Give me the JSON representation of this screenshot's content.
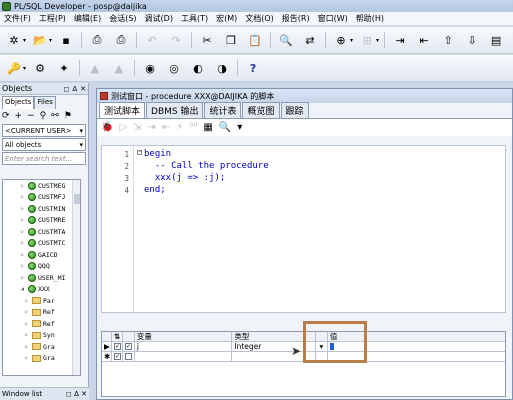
{
  "window": {
    "title": "PL/SQL Developer - posp@daijika"
  },
  "menu": [
    "文件(F)",
    "工程(P)",
    "编辑(E)",
    "会话(S)",
    "调试(D)",
    "工具(T)",
    "宏(M)",
    "文档(O)",
    "报告(R)",
    "窗口(W)",
    "帮助(H)"
  ],
  "objects_panel": {
    "title": "Objects",
    "tabs": [
      "Objects",
      "Files"
    ],
    "user_combo": "<CURRENT USER>",
    "filter_combo": "All objects",
    "search_placeholder": "Enter search text...",
    "tree": [
      {
        "label": "CUSTMEG",
        "type": "object"
      },
      {
        "label": "CUSTMFJ",
        "type": "object"
      },
      {
        "label": "CUSTMIN",
        "type": "object"
      },
      {
        "label": "CUSTMRE",
        "type": "object"
      },
      {
        "label": "CUSTMTA",
        "type": "object"
      },
      {
        "label": "CUSTMTC",
        "type": "object"
      },
      {
        "label": "GAICD",
        "type": "object"
      },
      {
        "label": "QQQ",
        "type": "object"
      },
      {
        "label": "USER_MI",
        "type": "object"
      },
      {
        "label": "XXX",
        "type": "object",
        "expanded": true
      },
      {
        "label": "Par",
        "type": "folder"
      },
      {
        "label": "Ref",
        "type": "folder"
      },
      {
        "label": "Ref",
        "type": "folder"
      },
      {
        "label": "Syn",
        "type": "folder"
      },
      {
        "label": "Gra",
        "type": "folder"
      },
      {
        "label": "Gra",
        "type": "folder"
      }
    ],
    "window_list_title": "Window list"
  },
  "test_window": {
    "title": "测试窗口 - procedure XXX@DAIJIKA 的脚本",
    "tabs": [
      "测试脚本",
      "DBMS 输出",
      "统计表",
      "概览图",
      "跟踪"
    ],
    "code_lines": [
      {
        "n": "1",
        "text": "begin"
      },
      {
        "n": "2",
        "text": "  -- Call the procedure"
      },
      {
        "n": "3",
        "text": "  xxx(j => :j);"
      },
      {
        "n": "4",
        "text": "end;"
      }
    ],
    "grid": {
      "headers": [
        "变量",
        "类型",
        "值"
      ],
      "rows": [
        {
          "variable": "j",
          "type": "Integer",
          "value": ""
        }
      ]
    }
  },
  "colors": {
    "highlight": "#b87d4b",
    "keyword": "#0000c0",
    "comment": "#e00000"
  }
}
